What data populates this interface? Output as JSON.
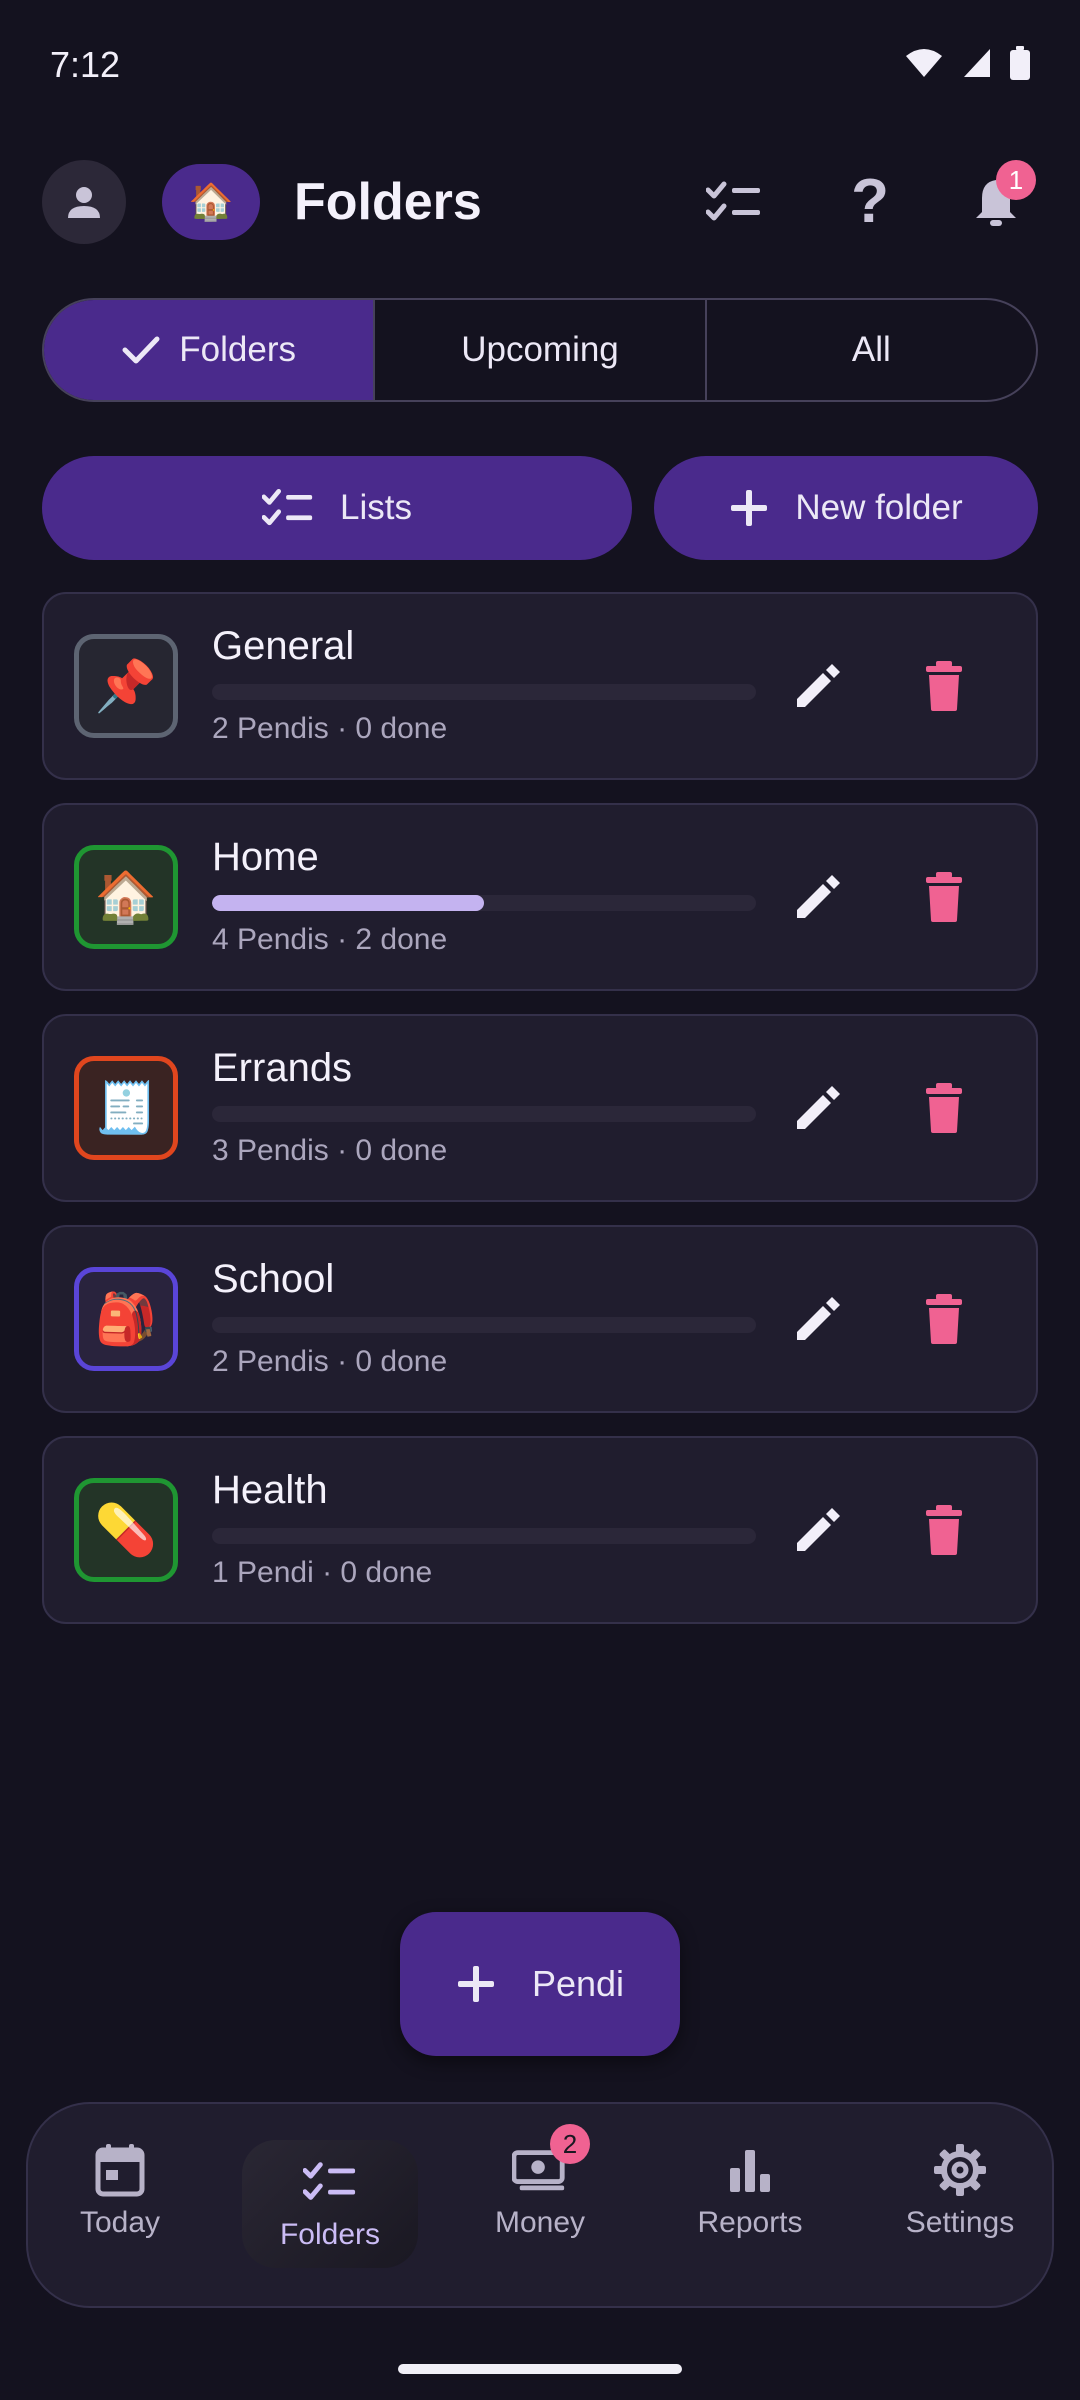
{
  "status_bar": {
    "time": "7:12"
  },
  "header": {
    "title": "Folders",
    "home_chip_icon": "🏠",
    "notification_count": "1"
  },
  "segmented": {
    "tabs": [
      {
        "label": "Folders",
        "selected": true
      },
      {
        "label": "Upcoming",
        "selected": false
      },
      {
        "label": "All",
        "selected": false
      }
    ]
  },
  "actions": {
    "lists_label": "Lists",
    "new_folder_label": "New folder"
  },
  "folders": [
    {
      "name": "General",
      "emoji": "📌",
      "meta": "2 Pendis · 0 done",
      "progress": 0,
      "border_color": "#5d6472",
      "bg_color": "#262631"
    },
    {
      "name": "Home",
      "emoji": "🏠",
      "meta": "4 Pendis · 2 done",
      "progress": 0.5,
      "border_color": "#1f9632",
      "bg_color": "#233427"
    },
    {
      "name": "Errands",
      "emoji": "🧾",
      "meta": "3 Pendis · 0 done",
      "progress": 0,
      "border_color": "#e0461e",
      "bg_color": "#3a2322"
    },
    {
      "name": "School",
      "emoji": "🎒",
      "meta": "2 Pendis · 0 done",
      "progress": 0,
      "border_color": "#5a45d8",
      "bg_color": "#29233d"
    },
    {
      "name": "Health",
      "emoji": "💊",
      "meta": "1 Pendi · 0 done",
      "progress": 0,
      "border_color": "#1f9632",
      "bg_color": "#233427"
    }
  ],
  "fab": {
    "label": "Pendi"
  },
  "bottom_nav": {
    "items": [
      {
        "label": "Today",
        "icon": "calendar-icon"
      },
      {
        "label": "Folders",
        "icon": "checklist-icon",
        "active": true
      },
      {
        "label": "Money",
        "icon": "money-icon",
        "badge": "2"
      },
      {
        "label": "Reports",
        "icon": "bar-chart-icon"
      },
      {
        "label": "Settings",
        "icon": "gear-icon"
      }
    ]
  },
  "colors": {
    "background": "#14121f",
    "accent": "#4a2a8c",
    "card": "#201d2e",
    "progress_fill": "#c4b3f0",
    "delete": "#f06292",
    "badge": "#f06292"
  }
}
